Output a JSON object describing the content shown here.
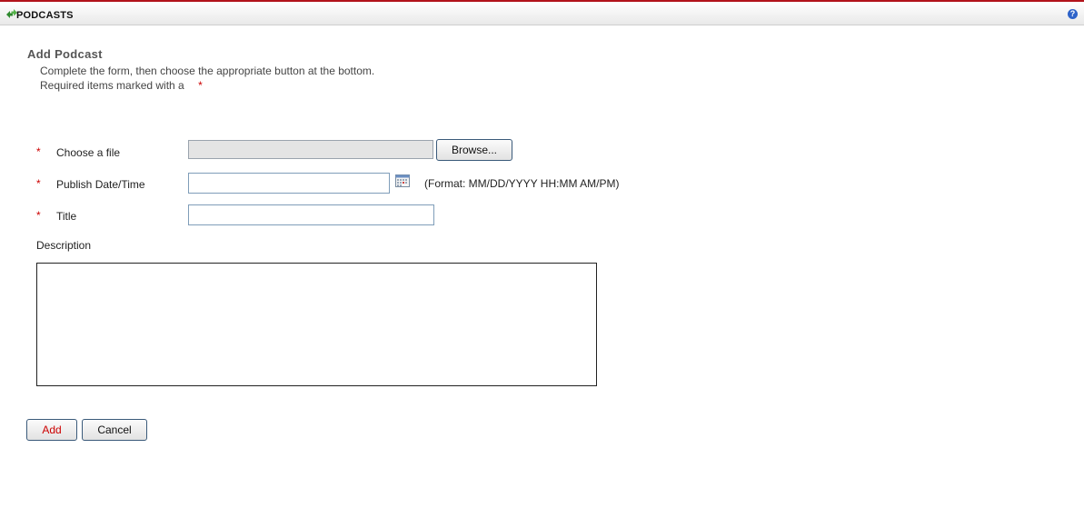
{
  "header": {
    "title": "PODCASTS"
  },
  "page": {
    "heading": "Add Podcast",
    "instruction_line1": "Complete the form, then choose the appropriate button at the bottom.",
    "instruction_line2": "Required items marked with a",
    "required_marker": "*"
  },
  "form": {
    "file": {
      "label": "Choose a file",
      "button_label": "Browse..."
    },
    "publish": {
      "label": "Publish Date/Time",
      "value": "",
      "format_hint": "(Format: MM/DD/YYYY HH:MM AM/PM)"
    },
    "title_field": {
      "label": "Title",
      "value": ""
    },
    "description": {
      "label": "Description",
      "value": ""
    }
  },
  "actions": {
    "add_label": "Add",
    "cancel_label": "Cancel"
  },
  "colors": {
    "accent": "#b2131b",
    "required": "#cc0000"
  },
  "icons": {
    "app": "podcast-arrows-icon",
    "help": "help-icon",
    "calendar": "calendar-icon"
  }
}
